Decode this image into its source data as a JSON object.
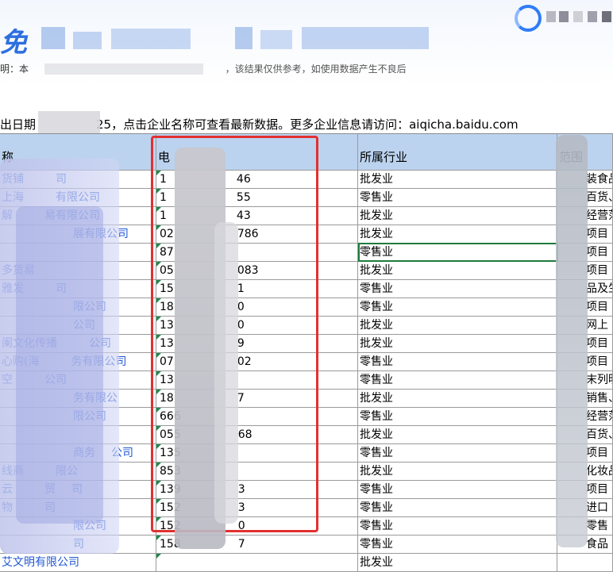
{
  "banner": {
    "title_visible": "免",
    "notice_visible": "明：本",
    "notice_fragment_2": "，该结果仅供参考，如使用数据产生不良后"
  },
  "info_line": {
    "prefix": "出日期",
    "suffix": "25，点击企业名称可查看最新数据。更多企业信息请访问：aiqicha.baidu.com"
  },
  "table": {
    "headers": {
      "name": "称",
      "phone": "电",
      "industry": "所属行业",
      "scope": "范围"
    },
    "rows": [
      {
        "name": "货铺",
        "name_tail": "司",
        "phone_head": "1",
        "phone_tail": "46",
        "industry": "批发业",
        "scope": "装食品"
      },
      {
        "name": "上海",
        "name_tail": "有限公司",
        "phone_head": "1",
        "phone_tail": "55",
        "industry": "零售业",
        "scope": "百货、"
      },
      {
        "name": "解",
        "name_tail": "易有限公司",
        "phone_head": "1",
        "phone_tail": "43",
        "industry": "批发业",
        "scope": "经营范"
      },
      {
        "name": "",
        "name_tail": "展有限公司",
        "phone_head": "02",
        "phone_tail": "786",
        "industry": "批发业",
        "scope": "项目"
      },
      {
        "name": "",
        "name_tail": "",
        "phone_head": "87",
        "phone_tail": "",
        "industry": "零售业",
        "scope": "项目"
      },
      {
        "name": "多货易",
        "name_tail": "",
        "phone_head": "05",
        "phone_tail": "083",
        "industry": "批发业",
        "scope": "项目"
      },
      {
        "name": "雅发",
        "name_tail": "司",
        "phone_head": "15",
        "phone_tail": "1",
        "industry": "零售业",
        "scope": "品及生"
      },
      {
        "name": "",
        "name_tail": "限公司",
        "phone_head": "18",
        "phone_tail": "0",
        "industry": "零售业",
        "scope": "项目"
      },
      {
        "name": "",
        "name_tail": "公司",
        "phone_head": "13",
        "phone_tail": "0",
        "industry": "批发业",
        "scope": "网上"
      },
      {
        "name": "阑文化传播",
        "name_tail": "公司",
        "phone_head": "13",
        "phone_tail": "9",
        "industry": "批发业",
        "scope": "项目"
      },
      {
        "name": "心购(海",
        "name_tail": "务有限公司",
        "phone_head": "07",
        "phone_tail": "02",
        "industry": "零售业",
        "scope": "项目"
      },
      {
        "name": "空",
        "name_tail": "公司",
        "phone_head": "13",
        "phone_tail": "",
        "industry": "零售业",
        "scope": "末列明"
      },
      {
        "name": "",
        "name_tail": "务有限公",
        "phone_head": "18",
        "phone_tail": "7",
        "industry": "批发业",
        "scope": "销售、"
      },
      {
        "name": "",
        "name_tail": "限公司",
        "phone_head": "666",
        "phone_tail": "",
        "industry": "零售业",
        "scope": "经营范"
      },
      {
        "name": "",
        "name_tail": "",
        "phone_head": "055",
        "phone_tail": "68",
        "industry": "批发业",
        "scope": "百货、"
      },
      {
        "name": "",
        "name_tail": "商务",
        "name_tail2": "公司",
        "phone_head": "135",
        "phone_tail": "",
        "industry": "零售业",
        "scope": "项目"
      },
      {
        "name": "线商",
        "name_tail": "限公",
        "phone_head": "853",
        "phone_tail": "",
        "industry": "批发业",
        "scope": "化妆品"
      },
      {
        "name": "云",
        "name_tail": "贸",
        "name_tail2": "司",
        "phone_head": "139",
        "phone_tail": "3",
        "industry": "零售业",
        "scope": "项目"
      },
      {
        "name": "物",
        "name_tail": "司",
        "phone_head": "152",
        "phone_tail": "3",
        "industry": "零售业",
        "scope": "进口"
      },
      {
        "name": "",
        "name_tail": "限公司",
        "phone_head": "152",
        "phone_tail": "0",
        "industry": "零售业",
        "scope": "零售"
      },
      {
        "name": "",
        "name_tail": "司",
        "phone_head": "158",
        "phone_tail": "7",
        "industry": "零售业",
        "scope": "食品"
      },
      {
        "name": "艾文明有限公司",
        "name_tail": "",
        "phone_head": "",
        "phone_tail": "",
        "industry": "批发业",
        "scope": ""
      }
    ]
  },
  "colors": {
    "header_bg": "#bcd3ef",
    "link_blue": "#1f57d6",
    "highlight_box": "#e23030",
    "brand_blue": "#2d6fe0"
  }
}
